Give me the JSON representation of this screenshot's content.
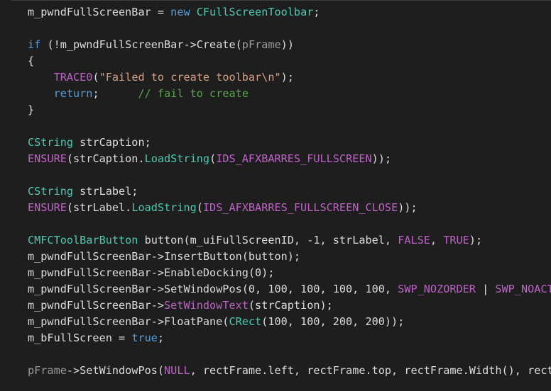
{
  "theme": {
    "background": "#1e1e1e",
    "colors": {
      "plain": "#dcdcdc",
      "keyword": "#569cd6",
      "type": "#4ec9b0",
      "macro": "#bd63c5",
      "member_fn": "#dcdcaa",
      "string": "#d69d85",
      "comment": "#57a64a",
      "param": "#9a9a9a",
      "enum": "#b8d7a3"
    }
  },
  "editor": {
    "lines": [
      [
        [
          "m_pwndFullScreenBar = ",
          "plain"
        ],
        [
          "new",
          "keyword"
        ],
        [
          " ",
          "plain"
        ],
        [
          "CFullScreenToolbar",
          "type"
        ],
        [
          ";",
          "plain"
        ]
      ],
      [],
      [
        [
          "if",
          "keyword"
        ],
        [
          " (!",
          "plain"
        ],
        [
          "m_pwndFullScreenBar",
          "plain"
        ],
        [
          "->",
          "plain"
        ],
        [
          "Create",
          "plain"
        ],
        [
          "(",
          "plain"
        ],
        [
          "pFrame",
          "param"
        ],
        [
          "))",
          "plain"
        ]
      ],
      [
        [
          "{",
          "plain"
        ]
      ],
      [
        [
          "    ",
          "plain"
        ],
        [
          "TRACE0",
          "macro"
        ],
        [
          "(",
          "plain"
        ],
        [
          "\"Failed to create toolbar\\n\"",
          "string"
        ],
        [
          ");",
          "plain"
        ]
      ],
      [
        [
          "    ",
          "plain"
        ],
        [
          "return",
          "keyword"
        ],
        [
          ";      ",
          "plain"
        ],
        [
          "// fail to create",
          "comment"
        ]
      ],
      [
        [
          "}",
          "plain"
        ]
      ],
      [],
      [
        [
          "CString",
          "type"
        ],
        [
          " strCaption;",
          "plain"
        ]
      ],
      [
        [
          "ENSURE",
          "macro"
        ],
        [
          "(strCaption.",
          "plain"
        ],
        [
          "LoadString",
          "type"
        ],
        [
          "(",
          "plain"
        ],
        [
          "IDS_AFXBARRES_FULLSCREEN",
          "macro"
        ],
        [
          "));",
          "plain"
        ]
      ],
      [],
      [
        [
          "CString",
          "type"
        ],
        [
          " strLabel;",
          "plain"
        ]
      ],
      [
        [
          "ENSURE",
          "macro"
        ],
        [
          "(strLabel.",
          "plain"
        ],
        [
          "LoadString",
          "type"
        ],
        [
          "(",
          "plain"
        ],
        [
          "IDS_AFXBARRES_FULLSCREEN_CLOSE",
          "macro"
        ],
        [
          "));",
          "plain"
        ]
      ],
      [],
      [
        [
          "CMFCToolBarButton",
          "type"
        ],
        [
          " button(m_uiFullScreenID, -1, strLabel, ",
          "plain"
        ],
        [
          "FALSE",
          "macro"
        ],
        [
          ", ",
          "plain"
        ],
        [
          "TRUE",
          "macro"
        ],
        [
          ");",
          "plain"
        ]
      ],
      [
        [
          "m_pwndFullScreenBar->InsertButton(button);",
          "plain"
        ]
      ],
      [
        [
          "m_pwndFullScreenBar->EnableDocking(0);",
          "plain"
        ]
      ],
      [
        [
          "m_pwndFullScreenBar->SetWindowPos(0, 100, 100, 100, 100, ",
          "plain"
        ],
        [
          "SWP_NOZORDER",
          "macro"
        ],
        [
          " | ",
          "plain"
        ],
        [
          "SWP_NOACTIVATE",
          "macro"
        ]
      ],
      [
        [
          "m_pwndFullScreenBar->",
          "plain"
        ],
        [
          "SetWindowText",
          "macro"
        ],
        [
          "(strCaption);",
          "plain"
        ]
      ],
      [
        [
          "m_pwndFullScreenBar->FloatPane(",
          "plain"
        ],
        [
          "CRect",
          "type"
        ],
        [
          "(100, 100, 200, 200));",
          "plain"
        ]
      ],
      [
        [
          "m_bFullScreen = ",
          "plain"
        ],
        [
          "true",
          "keyword"
        ],
        [
          ";",
          "plain"
        ]
      ],
      [],
      [
        [
          "pFrame",
          "param"
        ],
        [
          "->SetWindowPos(",
          "plain"
        ],
        [
          "NULL",
          "macro"
        ],
        [
          ", rectFrame.left, rectFrame.top, rectFrame.Width(), rectFrame.Height()",
          "plain"
        ]
      ]
    ]
  }
}
